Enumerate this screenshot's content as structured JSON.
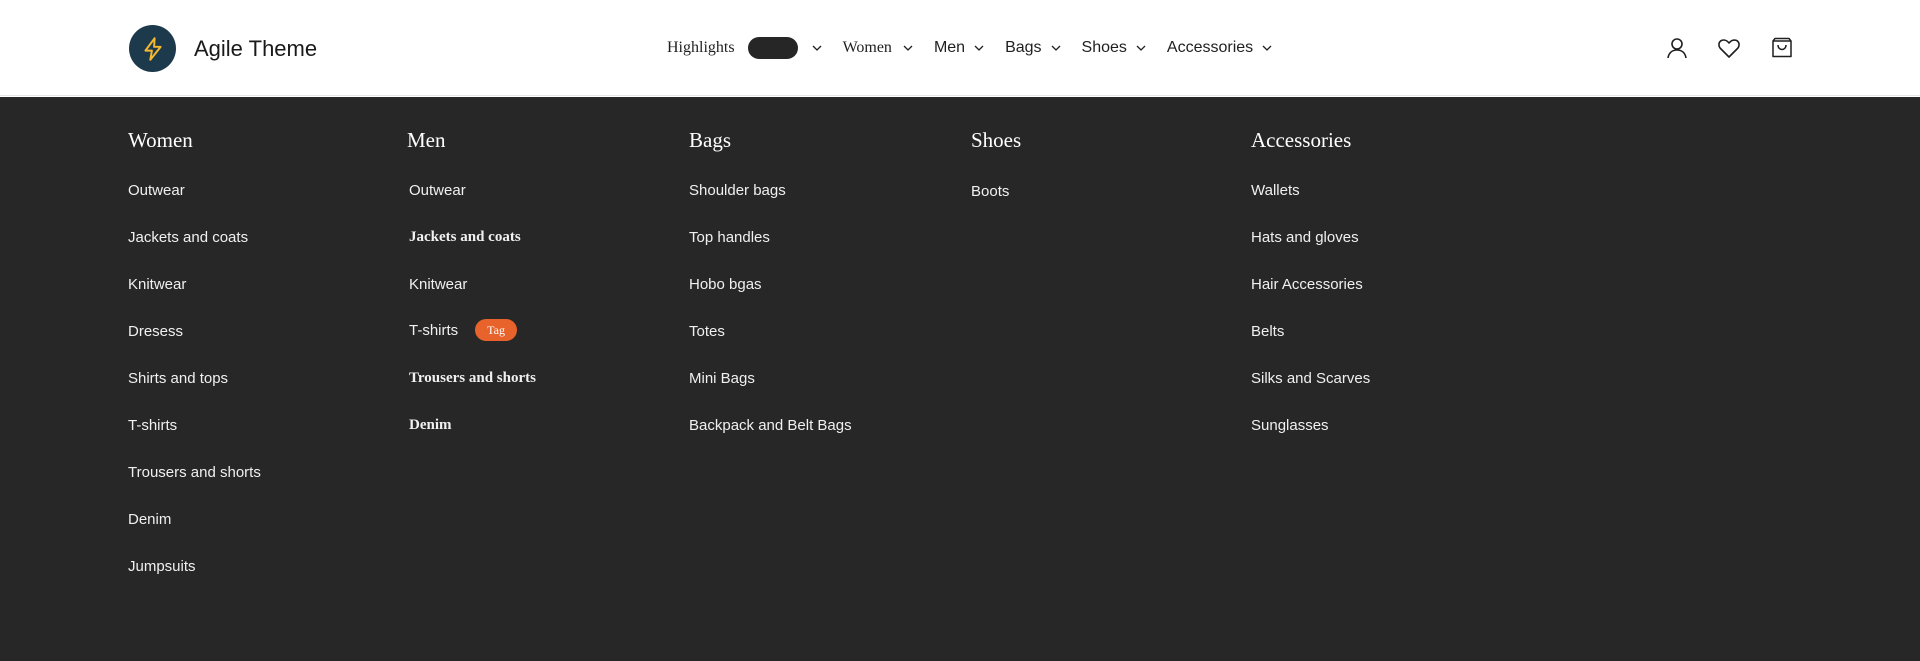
{
  "brand": {
    "name": "Agile Theme",
    "icon": "lightning-icon"
  },
  "nav": {
    "items": [
      {
        "label": "Highlights"
      },
      {
        "label": "Women"
      },
      {
        "label": "Men"
      },
      {
        "label": "Bags"
      },
      {
        "label": "Shoes"
      },
      {
        "label": "Accessories"
      }
    ]
  },
  "header_icons": [
    "user-icon",
    "heart-icon",
    "cart-icon"
  ],
  "menu": {
    "columns": [
      {
        "title": "Women",
        "items": [
          "Outwear",
          "Jackets and coats",
          "Knitwear",
          "Dresess",
          "Shirts and tops",
          "T-shirts",
          "Trousers and shorts",
          "Denim",
          "Jumpsuits"
        ]
      },
      {
        "title": "Men",
        "items": [
          "Outwear",
          "Jackets and coats",
          "Knitwear",
          "T-shirts",
          "Trousers and shorts",
          "Denim"
        ],
        "tag": "Tag"
      },
      {
        "title": "Bags",
        "items": [
          "Shoulder bags",
          "Top handles",
          "Hobo bgas",
          "Totes",
          "Mini Bags",
          "Backpack and Belt Bags"
        ]
      },
      {
        "title": "Shoes",
        "items": [
          "Boots"
        ]
      },
      {
        "title": "Accessories",
        "items": [
          "Wallets",
          "Hats and gloves",
          "Hair Accessories",
          "Belts",
          "Silks and Scarves",
          "Sunglasses"
        ]
      }
    ]
  },
  "colors": {
    "menu_bg": "#272727",
    "logo_bg": "#1d3a4c",
    "logo_bolt": "#f5b82e",
    "tag_bg": "#e8632b"
  }
}
